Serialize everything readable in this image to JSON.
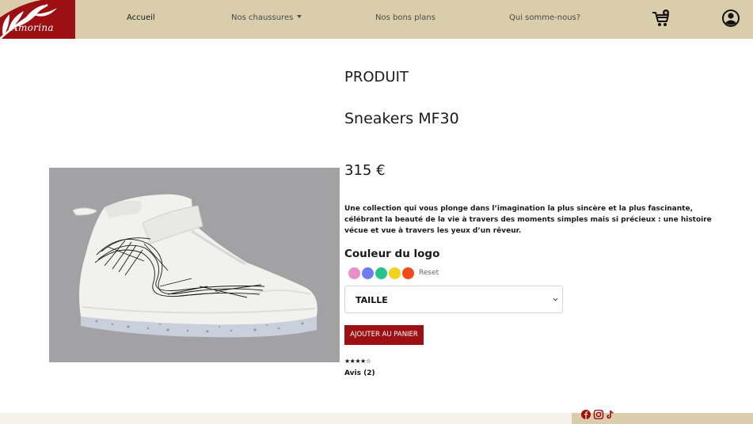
{
  "brand": {
    "name": "Amorina",
    "primary_color": "#9c0f13",
    "nav_bg": "#d9cdac"
  },
  "nav": {
    "items": [
      {
        "label": "Accueil",
        "active": true
      },
      {
        "label": "Nos chaussures",
        "dropdown": true
      },
      {
        "label": "Nos bons plans"
      },
      {
        "label": "Qui somme-nous?"
      }
    ],
    "cart_icon": "cart-icon",
    "account_icon": "user-circle-icon"
  },
  "product": {
    "section_title": "PRODUIT",
    "name": "Sneakers MF30",
    "price": "315 €",
    "description": "Une collection qui vous plonge dans l’imagination la plus sincère et la plus fascinante, célébrant la beauté de la vie à travers des moments simples mais si précieux : une histoire vécue et vue à travers les yeux d’un rêveur.",
    "color_title": "Couleur du logo",
    "colors": [
      "#e98fc9",
      "#6f7cf0",
      "#25c48a",
      "#f1d21c",
      "#f04a1a"
    ],
    "reset_label": "Reset",
    "size_placeholder": "TAILLE",
    "add_to_cart": "AJOUTER AU PANIER",
    "rating_stars": "★★★★☆",
    "reviews_label": "Avis (2)"
  },
  "footer": {
    "social_icons": [
      "facebook-icon",
      "instagram-icon",
      "tiktok-icon"
    ]
  }
}
